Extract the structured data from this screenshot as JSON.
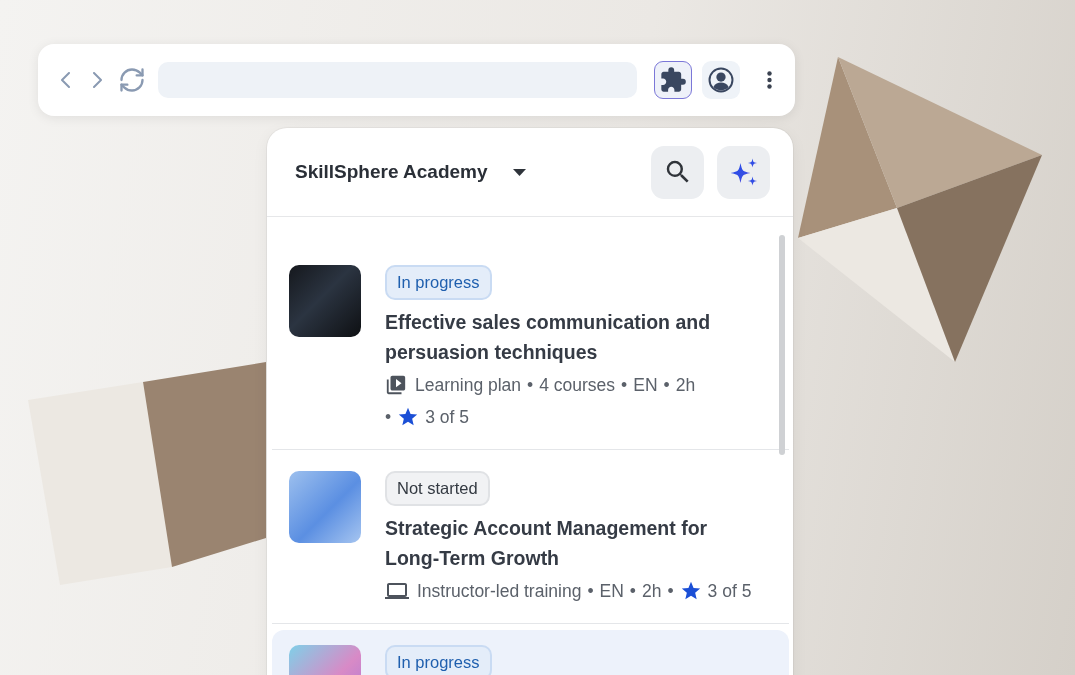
{
  "browser": {
    "nav": [
      {
        "kind": "back"
      },
      {
        "kind": "forward"
      },
      {
        "kind": "reload"
      }
    ],
    "actions": [
      {
        "kind": "extensions",
        "selected": true
      },
      {
        "kind": "profile",
        "selected": false
      },
      {
        "kind": "menu",
        "selected": false
      }
    ]
  },
  "panel": {
    "title": "SkillSphere Academy",
    "buttons": [
      {
        "kind": "search"
      },
      {
        "kind": "assistant"
      }
    ]
  },
  "meta_separator": "•",
  "courses": [
    {
      "selected": false,
      "status": {
        "kind": "in_progress",
        "label": "In progress"
      },
      "title": "Effective sales communication and persuasion techniques",
      "meta": {
        "kind": "learning_plan",
        "items": [
          "Learning plan",
          "4 courses",
          "EN",
          "2h"
        ],
        "rating": "3 of 5"
      }
    },
    {
      "selected": false,
      "status": {
        "kind": "not_started",
        "label": "Not started"
      },
      "title": "Strategic Account Management for Long-Term Growth",
      "meta": {
        "kind": "instructor_led",
        "items": [
          "Instructor-led training",
          "EN",
          "2h"
        ],
        "rating": "3 of 5"
      }
    },
    {
      "selected": true,
      "status": {
        "kind": "in_progress",
        "label": "In progress"
      }
    }
  ]
}
